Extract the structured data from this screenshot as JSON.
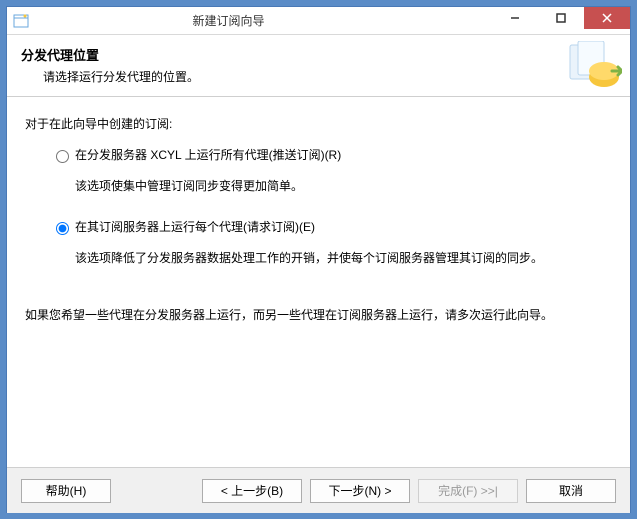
{
  "window": {
    "title": "新建订阅向导"
  },
  "header": {
    "title": "分发代理位置",
    "subtitle": "请选择运行分发代理的位置。"
  },
  "body": {
    "intro": "对于在此向导中创建的订阅:",
    "options": [
      {
        "label": "在分发服务器 XCYL 上运行所有代理(推送订阅)(R)",
        "description": "该选项使集中管理订阅同步变得更加简单。",
        "checked": false
      },
      {
        "label": "在其订阅服务器上运行每个代理(请求订阅)(E)",
        "description": "该选项降低了分发服务器数据处理工作的开销，并使每个订阅服务器管理其订阅的同步。",
        "checked": true
      }
    ],
    "note": "如果您希望一些代理在分发服务器上运行，而另一些代理在订阅服务器上运行，请多次运行此向导。"
  },
  "footer": {
    "help": "帮助(H)",
    "back": "< 上一步(B)",
    "next": "下一步(N) >",
    "finish": "完成(F) >>|",
    "cancel": "取消"
  }
}
